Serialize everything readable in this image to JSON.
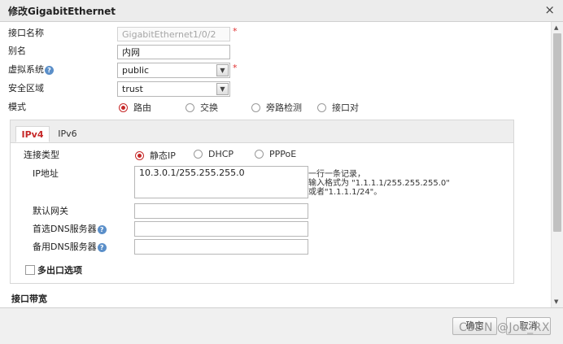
{
  "dialog": {
    "title": "修改GigabitEthernet",
    "close": "×"
  },
  "form": {
    "iface_name": {
      "label": "接口名称",
      "value": "GigabitEthernet1/0/2",
      "required": "*"
    },
    "alias": {
      "label": "别名",
      "value": "内网"
    },
    "vsys": {
      "label": "虚拟系统",
      "help": "?",
      "value": "public",
      "required": "*"
    },
    "zone": {
      "label": "安全区域",
      "value": "trust"
    },
    "mode": {
      "label": "模式",
      "options": [
        {
          "label": "路由",
          "selected": true
        },
        {
          "label": "交换",
          "selected": false
        },
        {
          "label": "旁路检测",
          "selected": false
        },
        {
          "label": "接口对",
          "selected": false
        }
      ]
    }
  },
  "tabs": [
    {
      "label": "IPv4",
      "active": true
    },
    {
      "label": "IPv6",
      "active": false
    }
  ],
  "ipv4": {
    "conn_type": {
      "label": "连接类型",
      "options": [
        {
          "label": "静态IP",
          "selected": true
        },
        {
          "label": "DHCP",
          "selected": false
        },
        {
          "label": "PPPoE",
          "selected": false
        }
      ]
    },
    "ip": {
      "label": "IP地址",
      "value": "10.3.0.1/255.255.255.0",
      "hint": [
        "一行一条记录，",
        "输入格式为 \"1.1.1.1/255.255.255.0\"",
        "或者\"1.1.1.1/24\"。"
      ]
    },
    "gateway": {
      "label": "默认网关",
      "value": ""
    },
    "dns1": {
      "label": "首选DNS服务器",
      "help": "?",
      "value": ""
    },
    "dns2": {
      "label": "备用DNS服务器",
      "help": "?",
      "value": ""
    },
    "multi_exit": {
      "label": "多出口选项",
      "checked": false
    }
  },
  "section": {
    "bandwidth": "接口带宽"
  },
  "footer": {
    "ok": "确定",
    "cancel": "取消",
    "watermark": "CSDN @Joe_RX"
  },
  "icons": {
    "close": "close-icon",
    "dropdown": "chevron-down-icon",
    "help": "help-icon"
  },
  "colors": {
    "accent": "#c62828",
    "required": "#e03030",
    "help": "#5b8fc9"
  }
}
